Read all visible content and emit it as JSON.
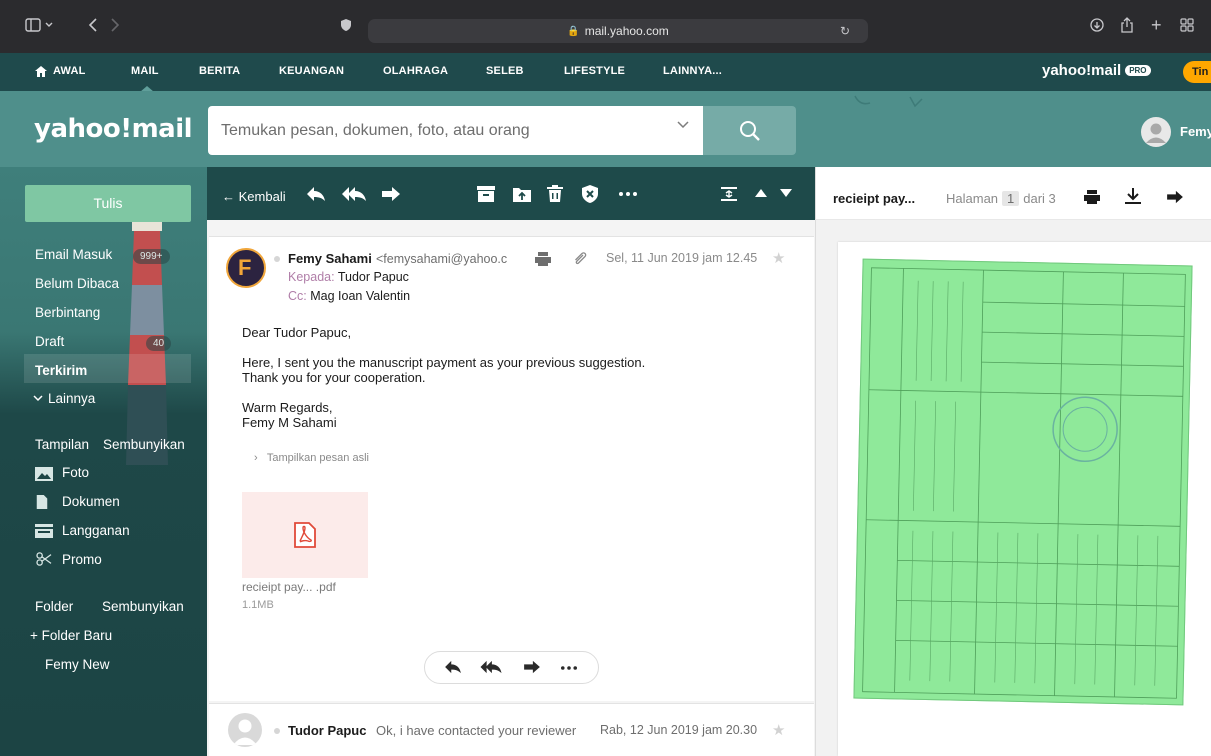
{
  "browser": {
    "url": "mail.yahoo.com"
  },
  "topnav": {
    "items": [
      "AWAL",
      "MAIL",
      "BERITA",
      "KEUANGAN",
      "OLAHRAGA",
      "SELEB",
      "LIFESTYLE",
      "LAINNYA..."
    ],
    "brand": "yahoo!mail",
    "brand_badge": "PRO",
    "upgrade_label": "Tin"
  },
  "header": {
    "logo": "yahoo!mail",
    "search_placeholder": "Temukan pesan, dokumen, foto, atau orang",
    "username": "Femy"
  },
  "sidebar": {
    "compose_label": "Tulis",
    "folders": [
      {
        "label": "Email Masuk",
        "count": "999+"
      },
      {
        "label": "Belum Dibaca"
      },
      {
        "label": "Berbintang"
      },
      {
        "label": "Draft",
        "count": "40"
      },
      {
        "label": "Terkirim"
      },
      {
        "label": "Lainnya"
      }
    ],
    "views_header": "Tampilan",
    "views_toggle": "Sembunyikan",
    "views": [
      "Foto",
      "Dokumen",
      "Langganan",
      "Promo"
    ],
    "folders_header": "Folder",
    "folders_toggle": "Sembunyikan",
    "new_folder": "+ Folder Baru",
    "user_folder": "Femy New"
  },
  "toolbar": {
    "back_label": "Kembali"
  },
  "message": {
    "sender_name": "Femy Sahami",
    "sender_email": "<femysahami@yahoo.c",
    "to_label": "Kepada:",
    "to_value": "Tudor Papuc",
    "cc_label": "Cc:",
    "cc_value": "Mag Ioan Valentin",
    "date": "Sel, 11 Jun 2019 jam 12.45",
    "body": [
      "Dear Tudor Papuc,",
      "Here, I sent you the manuscript payment as your previous suggestion.",
      "Thank you for your cooperation.",
      "Warm Regards,",
      "Femy M Sahami"
    ],
    "show_original": "Tampilkan pesan asli",
    "attachment_name": "recieipt pay... .pdf",
    "attachment_size": "1.1MB"
  },
  "message2": {
    "sender_name": "Tudor Papuc",
    "snippet": "Ok, i have contacted your reviewer",
    "date": "Rab, 12 Jun 2019 jam 20.30"
  },
  "preview": {
    "title": "recieipt pay...",
    "page_label": "Halaman",
    "page_current": "1",
    "page_of": "dari 3"
  },
  "colors": {
    "nav_bg": "#1f4a4c",
    "header_bg": "#4f8f8b",
    "compose_bg": "#7fc7a3",
    "upgrade_bg": "#ffa700",
    "document_green": "#8fe99a"
  }
}
